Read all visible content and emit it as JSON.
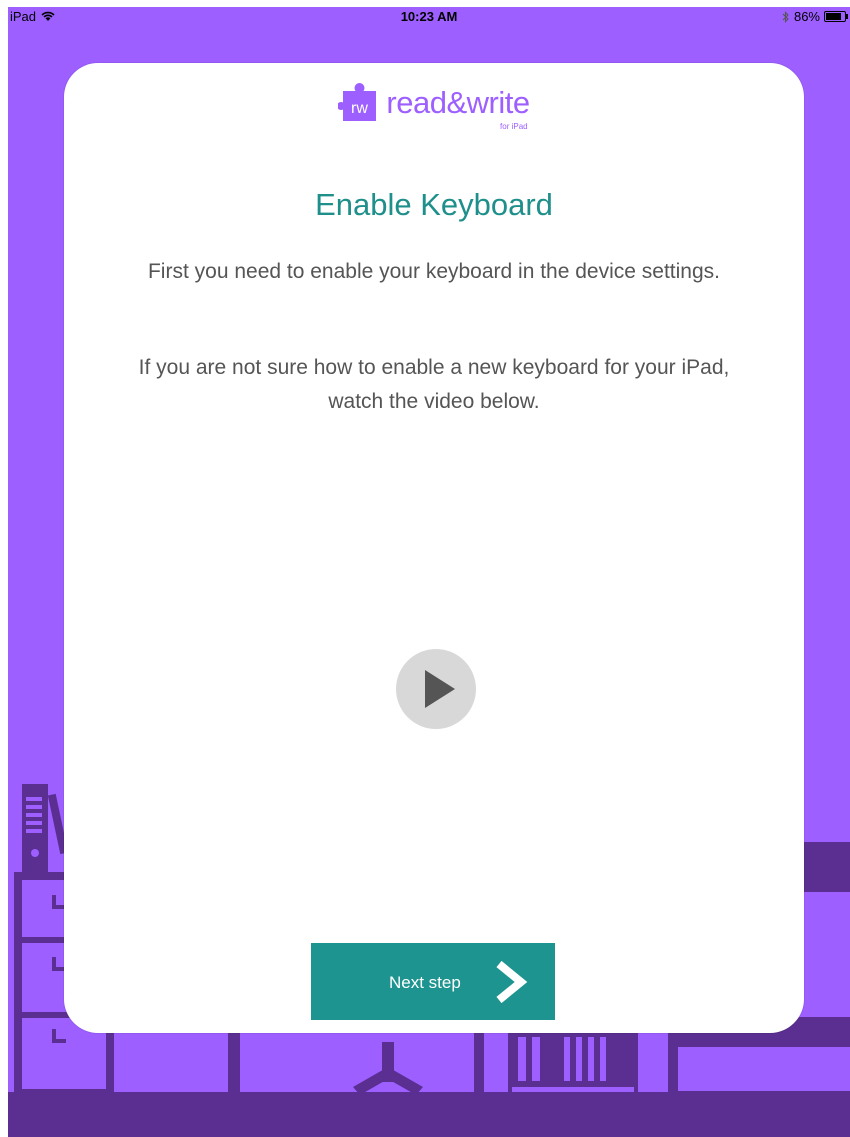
{
  "status_bar": {
    "device": "iPad",
    "time": "10:23 AM",
    "battery": "86%",
    "battery_level": 0.86
  },
  "logo": {
    "badge": "rw",
    "wordmark": "read&write",
    "subtitle": "for iPad"
  },
  "card": {
    "title": "Enable Keyboard",
    "paragraph1": "First you need to enable your keyboard in the device settings.",
    "paragraph2": "If you are not sure how to enable a new keyboard for your iPad, watch the video below."
  },
  "next_button": {
    "label": "Next step"
  },
  "colors": {
    "background": "#9d5fff",
    "furniture": "#5b2e91",
    "title": "#1e8f8a",
    "button": "#1e9490"
  },
  "icons": {
    "wifi": "wifi-icon",
    "bluetooth": "bluetooth-icon",
    "battery": "battery-icon",
    "play": "play-icon",
    "chevron": "chevron-right-icon"
  }
}
